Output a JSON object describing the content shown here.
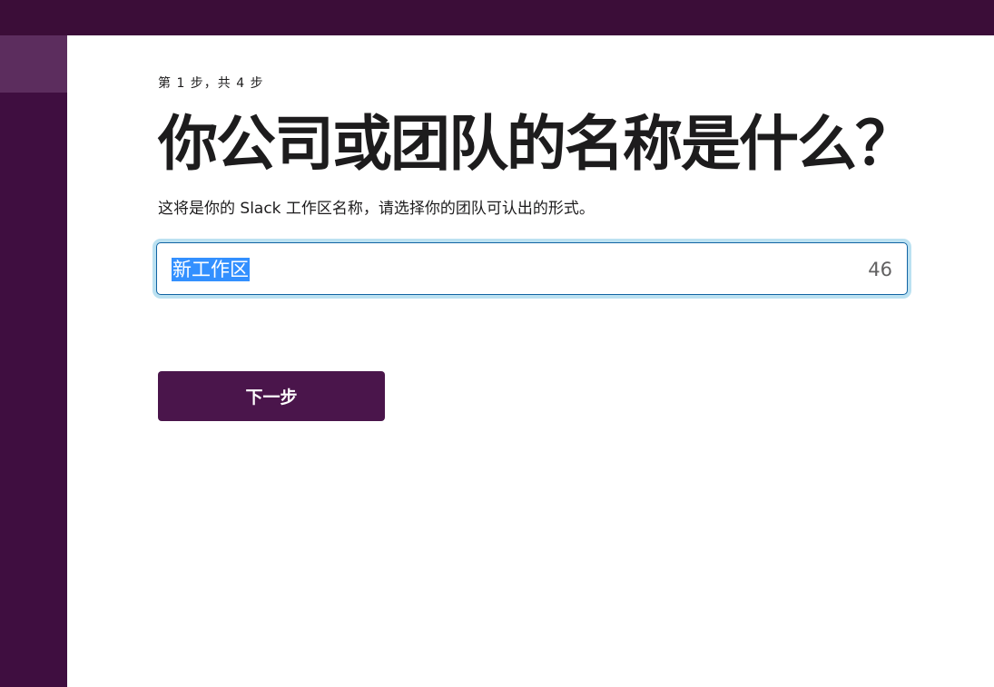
{
  "colors": {
    "topbar": "#3b0d38",
    "sidebar": "#3f0e40",
    "sidebar_tile": "#5c2d5e",
    "primary_button": "#4a154b",
    "input_border": "#1164a3",
    "selection": "#3390ff"
  },
  "onboarding": {
    "step_label": "第 1 步，共 4 步",
    "title": "你公司或团队的名称是什么？",
    "subtitle": "这将是你的 Slack 工作区名称，请选择你的团队可认出的形式。",
    "workspace_name_input": {
      "value": "新工作区",
      "remaining_chars": "46"
    },
    "next_button_label": "下一步"
  }
}
